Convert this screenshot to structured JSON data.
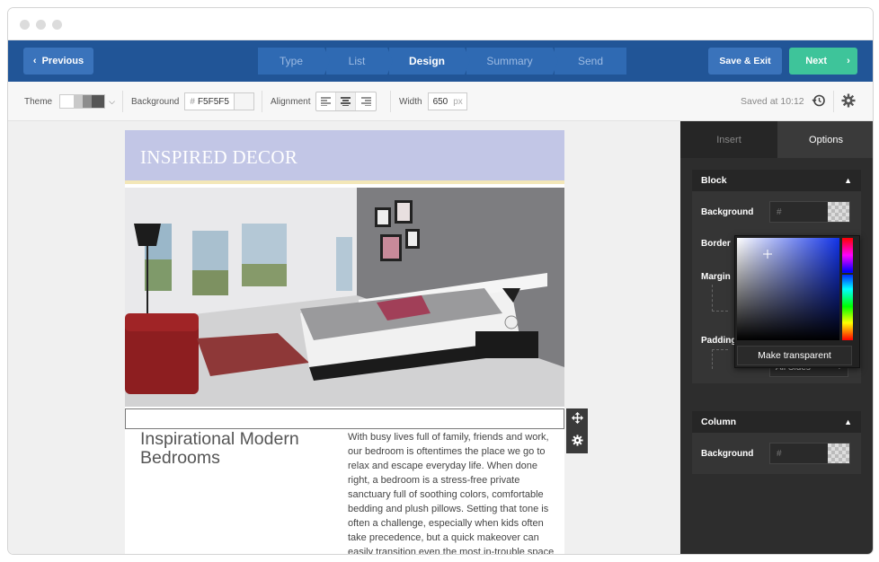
{
  "nav": {
    "prev_label": "Previous",
    "steps": [
      "Type",
      "List",
      "Design",
      "Summary",
      "Send"
    ],
    "active_step": "Design",
    "save_label": "Save & Exit",
    "next_label": "Next"
  },
  "toolbar": {
    "theme_label": "Theme",
    "theme_colors": [
      "#ffffff",
      "#c9c9c9",
      "#8d8d8d",
      "#555555"
    ],
    "background_label": "Background",
    "background_hash": "#",
    "background_value": "F5F5F5",
    "alignment_label": "Alignment",
    "width_label": "Width",
    "width_value": "650",
    "width_unit": "px",
    "saved_text": "Saved at 10:12"
  },
  "email": {
    "header_title": "INSPIRED DECOR",
    "heading": "Inspirational Modern Bedrooms",
    "body": "With busy lives full of family, friends and work, our bedroom is oftentimes the place we go to relax and escape everyday life. When done right, a bedroom is a stress-free private sanctuary full of soothing colors, comfortable bedding and plush pillows. Setting that tone is often a challenge, especially when kids often take precedence, but a quick makeover can easily transition even the most in-trouble space"
  },
  "panel": {
    "tab_insert": "Insert",
    "tab_options": "Options",
    "block": {
      "title": "Block",
      "background_label": "Background",
      "background_placeholder": "#",
      "border_label": "Border",
      "margin_label": "Margin",
      "padding_label": "Padding",
      "padding_sides": "All Sides"
    },
    "column": {
      "title": "Column",
      "background_label": "Background",
      "background_placeholder": "#"
    },
    "picker": {
      "transparent_label": "Make transparent"
    }
  },
  "colors": {
    "nav": "#215597",
    "accent_green": "#3ec49a",
    "header": "#c2c6e6"
  }
}
